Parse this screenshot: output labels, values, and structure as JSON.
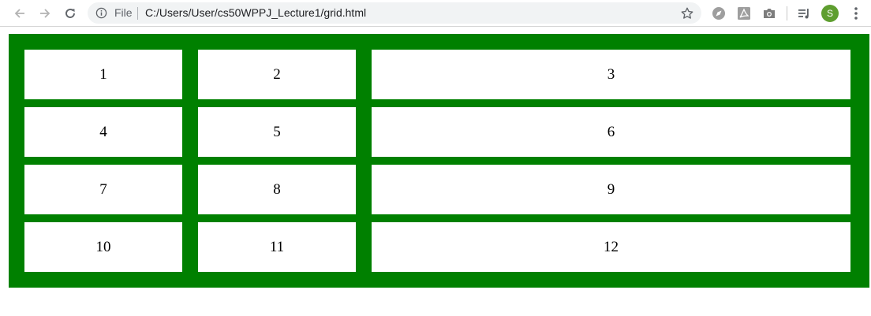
{
  "browser": {
    "scheme_label": "File",
    "url": "C:/Users/User/cs50WPPJ_Lecture1/grid.html",
    "profile_initial": "S",
    "icons": {
      "back": "back-arrow-icon",
      "forward": "forward-arrow-icon",
      "reload": "reload-icon",
      "site_info": "info-icon",
      "bookmark": "star-icon",
      "extensions": [
        "compass-extension-icon",
        "pdf-extension-icon",
        "camera-extension-icon",
        "media-controls-icon"
      ],
      "menu": "kebab-menu-icon"
    },
    "colors": {
      "avatar": "#5e9e2f",
      "omnibox": "#f1f3f4"
    }
  },
  "page": {
    "grid_background": "#008000",
    "cells": [
      "1",
      "2",
      "3",
      "4",
      "5",
      "6",
      "7",
      "8",
      "9",
      "10",
      "11",
      "12"
    ]
  }
}
